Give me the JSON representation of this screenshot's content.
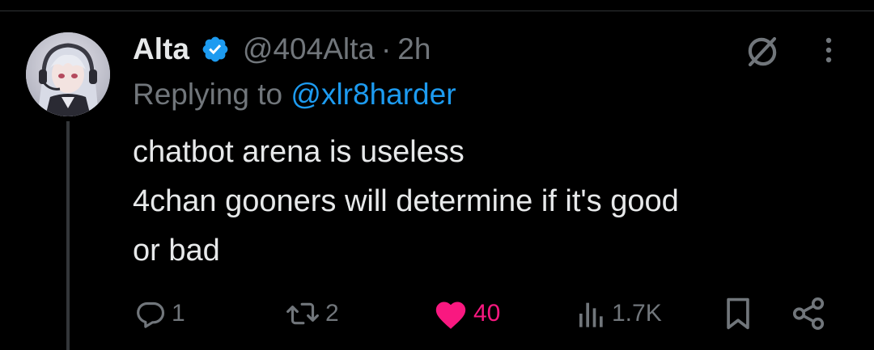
{
  "tweet": {
    "author_name": "Alta",
    "handle": "@404Alta",
    "separator": "·",
    "time": "2h",
    "replying_prefix": "Replying to ",
    "replying_to": "@xlr8harder",
    "body_lines": [
      "chatbot arena is useless",
      "4chan gooners will determine if it's good",
      "or bad"
    ]
  },
  "actions": {
    "replies": "1",
    "retweets": "2",
    "likes": "40",
    "views": "1.7K"
  },
  "colors": {
    "background": "#000000",
    "text": "#e7e9ea",
    "muted": "#71767b",
    "accent_blue": "#1d9bf0",
    "like_pink": "#f91880",
    "divider": "#2f3336"
  },
  "icons": {
    "verified": "verified-badge-icon",
    "grok": "grok-icon",
    "more": "more-dots-icon",
    "reply": "reply-bubble-icon",
    "retweet": "retweet-icon",
    "like": "heart-icon",
    "views": "views-bar-chart-icon",
    "bookmark": "bookmark-icon",
    "share": "share-icon"
  }
}
